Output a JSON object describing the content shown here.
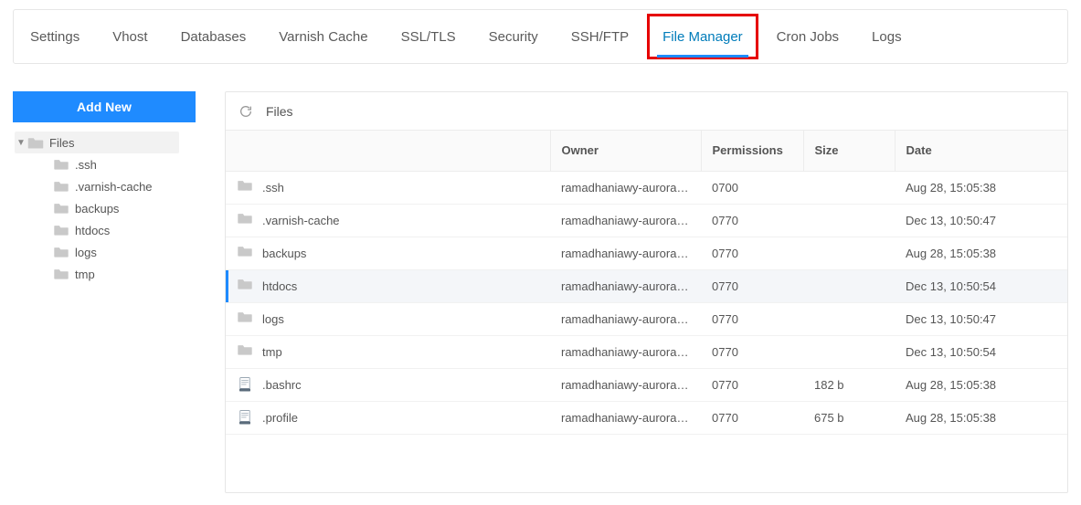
{
  "tabs": [
    {
      "label": "Settings",
      "active": false,
      "highlight": false
    },
    {
      "label": "Vhost",
      "active": false,
      "highlight": false
    },
    {
      "label": "Databases",
      "active": false,
      "highlight": false
    },
    {
      "label": "Varnish Cache",
      "active": false,
      "highlight": false
    },
    {
      "label": "SSL/TLS",
      "active": false,
      "highlight": false
    },
    {
      "label": "Security",
      "active": false,
      "highlight": false
    },
    {
      "label": "SSH/FTP",
      "active": false,
      "highlight": false
    },
    {
      "label": "File Manager",
      "active": true,
      "highlight": true
    },
    {
      "label": "Cron Jobs",
      "active": false,
      "highlight": false
    },
    {
      "label": "Logs",
      "active": false,
      "highlight": false
    }
  ],
  "sidebar": {
    "add_new_label": "Add New",
    "root_label": "Files",
    "children": [
      {
        "label": ".ssh"
      },
      {
        "label": ".varnish-cache"
      },
      {
        "label": "backups"
      },
      {
        "label": "htdocs"
      },
      {
        "label": "logs"
      },
      {
        "label": "tmp"
      }
    ]
  },
  "panel": {
    "title": "Files",
    "columns": {
      "name": "",
      "owner": "Owner",
      "permissions": "Permissions",
      "size": "Size",
      "date": "Date"
    },
    "rows": [
      {
        "type": "dir",
        "name": ".ssh",
        "owner": "ramadhaniawy-aurora:ramadhaniawy-aurora",
        "permissions": "0700",
        "size": "",
        "date": "Aug 28, 15:05:38",
        "hovered": false
      },
      {
        "type": "dir",
        "name": ".varnish-cache",
        "owner": "ramadhaniawy-aurora:ramadhaniawy-aurora",
        "permissions": "0770",
        "size": "",
        "date": "Dec 13, 10:50:47",
        "hovered": false
      },
      {
        "type": "dir",
        "name": "backups",
        "owner": "ramadhaniawy-aurora:ramadhaniawy-aurora",
        "permissions": "0770",
        "size": "",
        "date": "Aug 28, 15:05:38",
        "hovered": false
      },
      {
        "type": "dir",
        "name": "htdocs",
        "owner": "ramadhaniawy-aurora:ramadhaniawy-aurora",
        "permissions": "0770",
        "size": "",
        "date": "Dec 13, 10:50:54",
        "hovered": true
      },
      {
        "type": "dir",
        "name": "logs",
        "owner": "ramadhaniawy-aurora:ramadhaniawy-aurora",
        "permissions": "0770",
        "size": "",
        "date": "Dec 13, 10:50:47",
        "hovered": false
      },
      {
        "type": "dir",
        "name": "tmp",
        "owner": "ramadhaniawy-aurora:ramadhaniawy-aurora",
        "permissions": "0770",
        "size": "",
        "date": "Dec 13, 10:50:54",
        "hovered": false
      },
      {
        "type": "file",
        "name": ".bashrc",
        "owner": "ramadhaniawy-aurora:ramadhaniawy-aurora",
        "permissions": "0770",
        "size": "182 b",
        "date": "Aug 28, 15:05:38",
        "hovered": false
      },
      {
        "type": "file",
        "name": ".profile",
        "owner": "ramadhaniawy-aurora:ramadhaniawy-aurora",
        "permissions": "0770",
        "size": "675 b",
        "date": "Aug 28, 15:05:38",
        "hovered": false
      }
    ]
  }
}
